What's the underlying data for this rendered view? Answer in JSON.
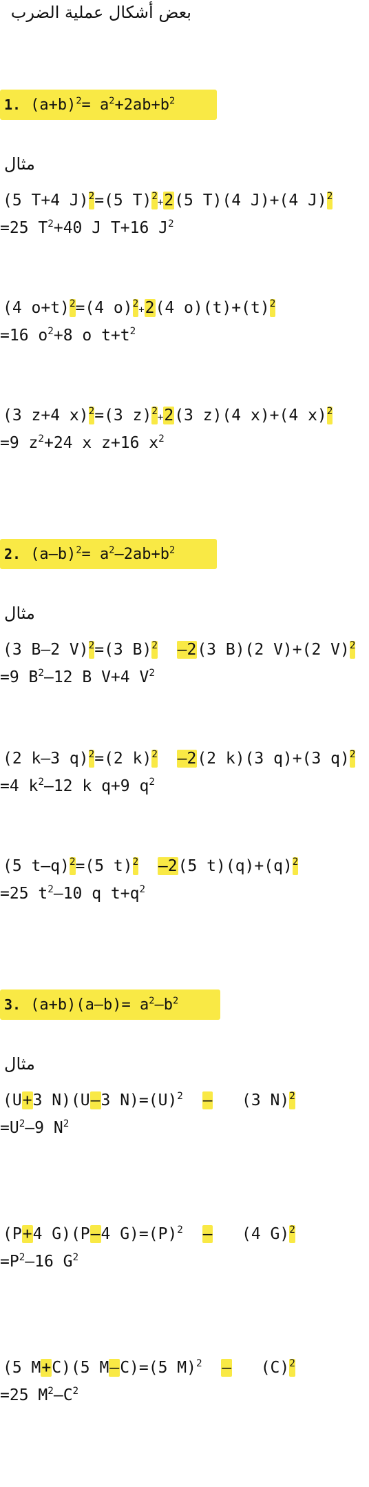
{
  "page_title": "بعض أشكال عملية الضرب",
  "example_label": "مثال",
  "section1": {
    "number": "1.",
    "formula": {
      "lhs": "(a+b)",
      "rhs_a": "a",
      "rhs_mid": "+2ab+b"
    }
  },
  "section2": {
    "number": "2.",
    "formula": {
      "lhs": "(a–b)",
      "rhs_a": "a",
      "rhs_mid": "–2ab+b"
    }
  },
  "section3": {
    "number": "3.",
    "formula": {
      "lhs": "(a+b)(a–b)=",
      "rhs_a": "a",
      "rhs_mid": "–b"
    }
  },
  "examples1": [
    {
      "l1a": "(5 T+4 J)",
      "l1b": "=(5 T)",
      "l1c": "+",
      "l1d": "2",
      "l1e": "(5 T)(4 J)+(4 J)",
      "l2a": "=25 T",
      "l2b": "+40 J T+16 J"
    },
    {
      "l1a": "(4 o+t)",
      "l1b": "=(4 o)",
      "l1c": "+",
      "l1d": "2",
      "l1e": "(4 o)(t)+(t)",
      "l2a": "=16 o",
      "l2b": "+8 o t+t"
    },
    {
      "l1a": "(3 z+4 x)",
      "l1b": "=(3 z)",
      "l1c": "+",
      "l1d": "2",
      "l1e": "(3 z)(4 x)+(4 x)",
      "l2a": "=9 z",
      "l2b": "+24 x z+16 x"
    }
  ],
  "examples2": [
    {
      "l1a": "(3 B–2 V)",
      "l1b": "=(3 B)",
      "l1d": "–2",
      "l1e": "(3 B)(2 V)+(2 V)",
      "l2a": "=9 B",
      "l2b": "–12 B V+4 V"
    },
    {
      "l1a": "(2 k–3 q)",
      "l1b": "=(2 k)",
      "l1d": "–2",
      "l1e": "(2 k)(3 q)+(3 q)",
      "l2a": "=4 k",
      "l2b": "–12 k q+9 q"
    },
    {
      "l1a": "(5 t–q)",
      "l1b": "=(5 t)",
      "l1d": "–2",
      "l1e": "(5 t)(q)+(q)",
      "l2a": "=25 t",
      "l2b": "–10 q t+q"
    }
  ],
  "examples3": [
    {
      "p1": "(U",
      "p2": "+",
      "p3": "3 N)(U",
      "p4": "–",
      "p5": "3 N)=(U)",
      "p6": "–",
      "p7": "(3 N)",
      "l2a": "=U",
      "l2b": "–9 N"
    },
    {
      "p1": "(P",
      "p2": "+",
      "p3": "4 G)(P",
      "p4": "–",
      "p5": "4 G)=(P)",
      "p6": "–",
      "p7": "(4 G)",
      "l2a": "=P",
      "l2b": "–16 G"
    },
    {
      "p1": "(5 M",
      "p2": "+",
      "p3": "C)(5 M",
      "p4": "–",
      "p5": "C)=(5 M)",
      "p6": "–",
      "p7": "(C)",
      "l2a": "=25 M",
      "l2b": "–C"
    }
  ],
  "exponent": "2",
  "colors": {
    "highlight": "#f9e945",
    "text": "#111111",
    "background": "#ffffff"
  }
}
